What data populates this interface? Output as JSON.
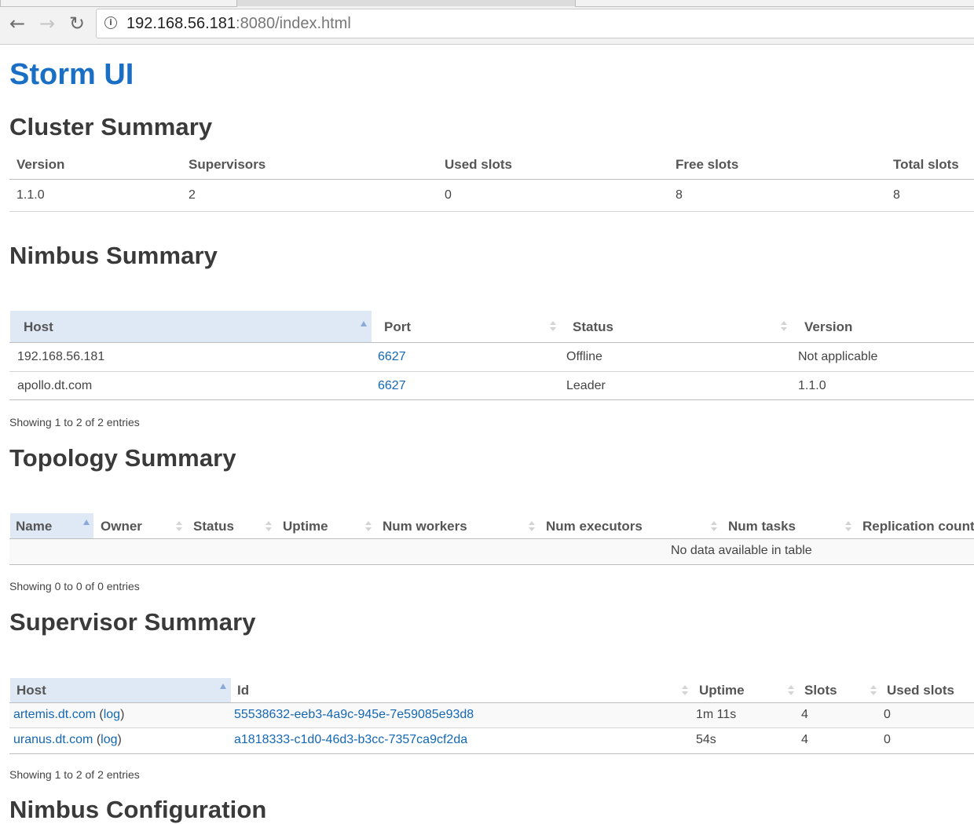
{
  "browser": {
    "url_host": "192.168.56.181",
    "url_rest": ":8080/index.html",
    "info_icon": "info-icon",
    "back_icon": "back-arrow-icon",
    "forward_icon": "forward-arrow-icon",
    "reload_icon": "reload-icon"
  },
  "brand": "Storm UI",
  "cluster": {
    "title": "Cluster Summary",
    "headers": [
      "Version",
      "Supervisors",
      "Used slots",
      "Free slots",
      "Total slots"
    ],
    "values": [
      "1.1.0",
      "2",
      "0",
      "8",
      "8"
    ]
  },
  "nimbus": {
    "title": "Nimbus Summary",
    "headers": [
      "Host",
      "Port",
      "Status",
      "Version"
    ],
    "rows": [
      [
        "192.168.56.181",
        "6627",
        "Offline",
        "Not applicable"
      ],
      [
        "apollo.dt.com",
        "6627",
        "Leader",
        "1.1.0"
      ]
    ],
    "info": "Showing 1 to 2 of 2 entries"
  },
  "topology": {
    "title": "Topology Summary",
    "headers": [
      "Name",
      "Owner",
      "Status",
      "Uptime",
      "Num workers",
      "Num executors",
      "Num tasks",
      "Replication count"
    ],
    "empty": "No data available in table",
    "info": "Showing 0 to 0 of 0 entries"
  },
  "supervisor": {
    "title": "Supervisor Summary",
    "headers": [
      "Host",
      "Id",
      "Uptime",
      "Slots",
      "Used slots"
    ],
    "rows": [
      {
        "host": "artemis.dt.com",
        "log_open": " (",
        "log": "log",
        "log_close": ")",
        "id": "55538632-eeb3-4a9c-945e-7e59085e93d8",
        "uptime": "1m 11s",
        "slots": "4",
        "used": "0"
      },
      {
        "host": "uranus.dt.com",
        "log_open": " (",
        "log": "log",
        "log_close": ")",
        "id": "a1818333-c1d0-46d3-b3cc-7357ca9cf2da",
        "uptime": "54s",
        "slots": "4",
        "used": "0"
      }
    ],
    "info": "Showing 1 to 2 of 2 entries"
  },
  "nimbus_config": {
    "title": "Nimbus Configuration"
  },
  "colors": {
    "brand": "#1a6fc4",
    "link": "#1467b3",
    "sorted_header_bg": "#dfe9f6"
  }
}
